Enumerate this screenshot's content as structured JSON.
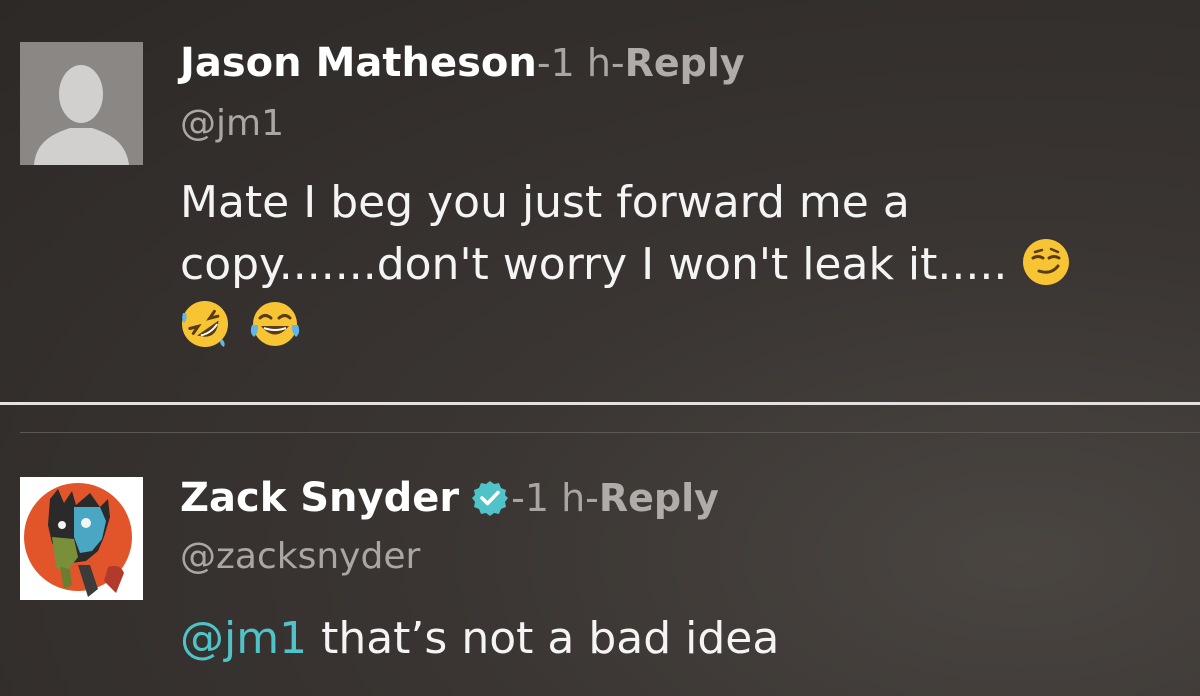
{
  "comments": [
    {
      "author": "Jason Matheson",
      "separator": " - ",
      "time": "1 h",
      "reply_label": "Reply",
      "handle": "@jm1",
      "verified": false,
      "avatar_icon": "default-user-silhouette-icon",
      "text_line1": "Mate I beg you just forward me a",
      "text_line2": "copy.......don't worry I won't leak it.....",
      "emojis": [
        "smirking-face-icon",
        "rolling-on-floor-laughing-icon",
        "face-with-tears-of-joy-icon"
      ]
    },
    {
      "author": "Zack Snyder",
      "separator": " - ",
      "time": "1 h",
      "reply_label": "Reply",
      "handle": "@zacksnyder",
      "verified": true,
      "avatar_icon": "zombie-illustration-avatar-icon",
      "mention": "@jm1",
      "text": " that’s not a bad idea"
    }
  ],
  "colors": {
    "mention": "#4fc3c8",
    "verified_badge": "#4fc3c8",
    "divider": "#e4e1de"
  }
}
